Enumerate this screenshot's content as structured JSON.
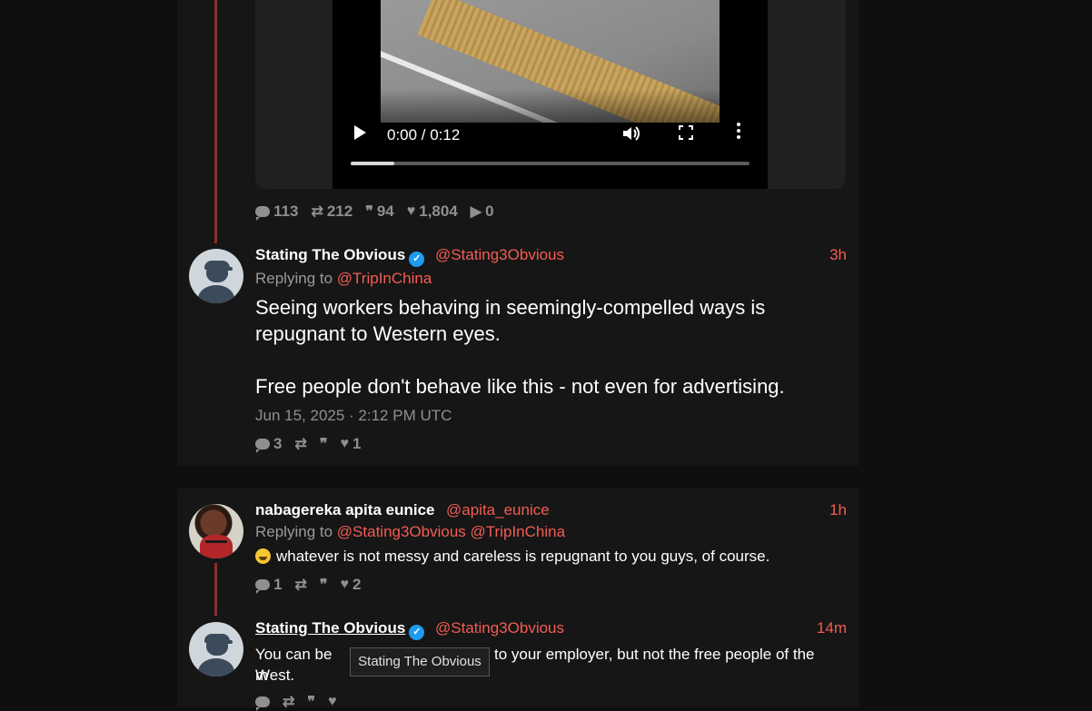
{
  "video": {
    "time": "0:00 / 0:12",
    "progress_fraction": 0.11
  },
  "stats_main": {
    "replies": "113",
    "retweets": "212",
    "quotes": "94",
    "likes": "1,804",
    "plays": "0"
  },
  "tweet1": {
    "name": "Stating The Obvious",
    "handle": "@Stating3Obvious",
    "time": "3h",
    "replying_prefix": "Replying to",
    "replying_to": "@TripInChina",
    "text_p1": "Seeing workers behaving in seemingly-compelled ways is repugnant to Western eyes.",
    "text_p2": "Free people don't behave like this - not even for advertising.",
    "date": "Jun 15, 2025 · 2:12 PM UTC",
    "stats": {
      "replies": "3",
      "retweets": "",
      "quotes": "",
      "likes": "1"
    }
  },
  "tweet2": {
    "name": "nabagereka apita eunice",
    "handle": "@apita_eunice",
    "time": "1h",
    "replying_prefix": "Replying to",
    "replying_to_1": "@Stating3Obvious",
    "replying_to_2": "@TripInChina",
    "text": "whatever is not messy and careless is repugnant to you guys, of course.",
    "stats": {
      "replies": "1",
      "retweets": "",
      "quotes": "",
      "likes": "2"
    }
  },
  "tweet3": {
    "name": "Stating The Obvious",
    "handle": "@Stating3Obvious",
    "time": "14m",
    "text_part1": "You can be m",
    "text_part2": "to your employer, but not the free people of the West."
  },
  "tooltip": "Stating The Obvious",
  "icons": [
    "play-icon",
    "volume-icon",
    "fullscreen-icon",
    "more-icon",
    "reply-icon",
    "retweet-icon",
    "quote-icon",
    "heart-icon",
    "play-count-icon",
    "verified-icon"
  ]
}
